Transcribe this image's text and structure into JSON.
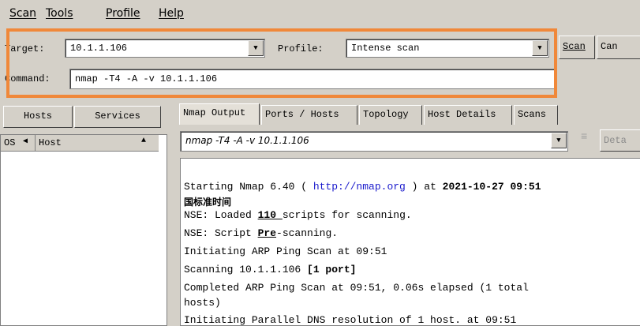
{
  "menu": {
    "items": [
      "Scan",
      "Tools",
      "Profile",
      "Help"
    ]
  },
  "toolbar": {
    "target_label": "Target:",
    "target_value": "10.1.1.106",
    "profile_label": "Profile:",
    "profile_value": "Intense scan",
    "scan_label": "Scan",
    "cancel_label": "Can",
    "command_label": "Command:",
    "command_value": "nmap -T4 -A -v 10.1.1.106"
  },
  "left_panel": {
    "hosts_tab": "Hosts",
    "services_tab": "Services",
    "col_os": "OS",
    "col_host": "Host"
  },
  "right_panel": {
    "tabs": [
      "Nmap Output",
      "Ports / Hosts",
      "Topology",
      "Host Details",
      "Scans"
    ],
    "output_select": "nmap -T4 -A -v 10.1.1.106",
    "details_label": "Deta",
    "output_lines": {
      "l1a": "Starting Nmap 6.40 ( ",
      "l1link": "http://nmap.org",
      "l1b": " ) at ",
      "l1date": "2021-10-27 09:51",
      "l2": "国标准时间",
      "l3a": "NSE: Loaded ",
      "l3num": "110 ",
      "l3b": "scripts for scanning.",
      "l4a": "NSE: Script ",
      "l4pre": "Pre",
      "l4b": "-scanning.",
      "l5": "Initiating ARP Ping Scan at 09:51",
      "l6a": "Scanning 10.1.1.106 ",
      "l6b": "[1 port]",
      "l7": "Completed ARP Ping Scan at 09:51, 0.06s elapsed (1 total",
      "l8": "hosts)",
      "l9": "Initiating Parallel DNS resolution of 1 host. at 09:51"
    }
  },
  "colors": {
    "highlight": "#f0883a",
    "link": "#1a1acc"
  }
}
